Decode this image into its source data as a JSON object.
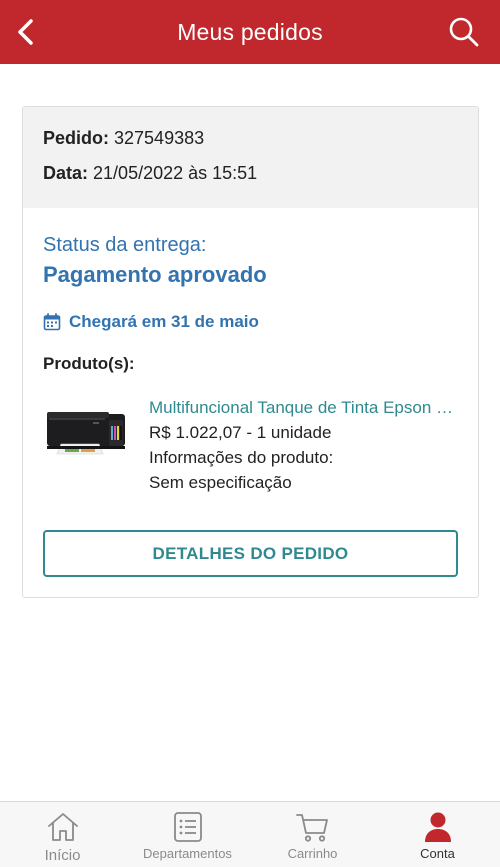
{
  "header": {
    "title": "Meus pedidos"
  },
  "order": {
    "number_label": "Pedido:",
    "number_value": "327549383",
    "date_label": "Data:",
    "date_value": "21/05/2022 às 15:51"
  },
  "delivery": {
    "status_label": "Status da entrega:",
    "status_value": "Pagamento aprovado",
    "eta_text": "Chegará em 31 de maio"
  },
  "products": {
    "label": "Produto(s):",
    "items": [
      {
        "name": "Multifuncional Tanque de Tinta Epson EcoTank",
        "price_qty": "R$ 1.022,07 - 1 unidade",
        "info_label": "Informações do produto:",
        "spec": "Sem especificação"
      }
    ]
  },
  "actions": {
    "details_button": "DETALHES DO PEDIDO"
  },
  "bottom_nav": {
    "items": [
      {
        "label": "Início",
        "icon": "home-icon"
      },
      {
        "label": "Departamentos",
        "icon": "list-icon"
      },
      {
        "label": "Carrinho",
        "icon": "cart-icon"
      },
      {
        "label": "Conta",
        "icon": "user-icon",
        "active": true
      }
    ]
  },
  "colors": {
    "header_bg": "#c0282d",
    "status_blue": "#3273b0",
    "teal": "#2e8a8f"
  }
}
